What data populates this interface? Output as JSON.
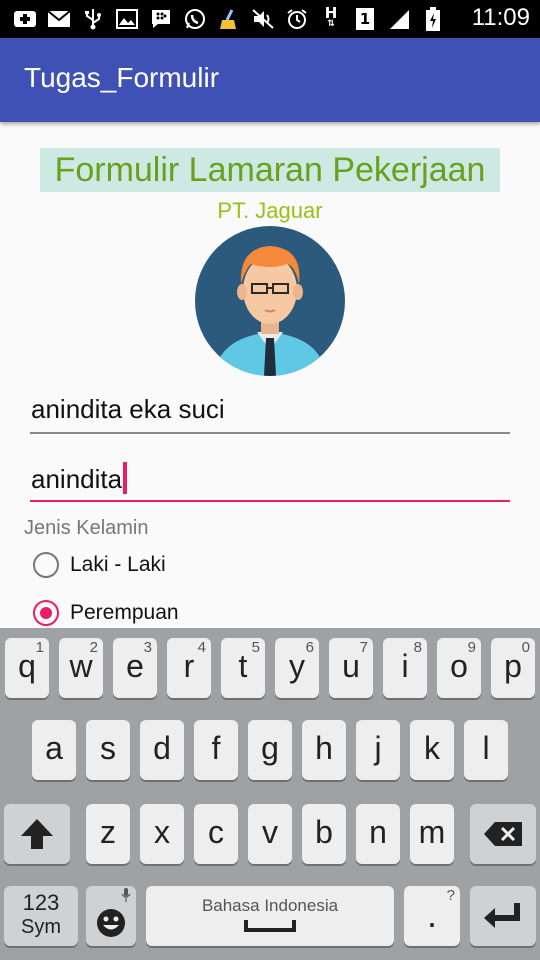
{
  "status_bar": {
    "time": "11:09",
    "icons": [
      "plus-icon",
      "mail-icon",
      "usb-icon",
      "image-icon",
      "bbm-icon",
      "whatsapp-icon",
      "cleaner-icon",
      "mute-icon",
      "alarm-icon",
      "h-signal-icon",
      "sim1-icon",
      "signal-icon",
      "battery-icon"
    ],
    "h_text": "H",
    "sim_text": "1"
  },
  "app_bar": {
    "title": "Tugas_Formulir",
    "color": "#3f51b5"
  },
  "form": {
    "title": "Formulir Lamaran Pekerjaan",
    "subtitle": "PT. Jaguar",
    "field1_value": "anindita eka suci",
    "field2_value": "anindita",
    "gender_label": "Jenis Kelamin",
    "gender_options": [
      {
        "label": "Laki - Laki",
        "checked": false
      },
      {
        "label": "Perempuan",
        "checked": true
      }
    ],
    "accent_color": "#e91e63",
    "title_color": "#6aa11c",
    "title_bg": "#cde9e3",
    "subtitle_color": "#96c11a"
  },
  "keyboard": {
    "row1": [
      {
        "k": "q",
        "h": "1"
      },
      {
        "k": "w",
        "h": "2"
      },
      {
        "k": "e",
        "h": "3"
      },
      {
        "k": "r",
        "h": "4"
      },
      {
        "k": "t",
        "h": "5"
      },
      {
        "k": "y",
        "h": "6"
      },
      {
        "k": "u",
        "h": "7"
      },
      {
        "k": "i",
        "h": "8"
      },
      {
        "k": "o",
        "h": "9"
      },
      {
        "k": "p",
        "h": "0"
      }
    ],
    "row2": [
      {
        "k": "a"
      },
      {
        "k": "s"
      },
      {
        "k": "d"
      },
      {
        "k": "f"
      },
      {
        "k": "g"
      },
      {
        "k": "h"
      },
      {
        "k": "j"
      },
      {
        "k": "k"
      },
      {
        "k": "l"
      }
    ],
    "row3": [
      {
        "k": "z"
      },
      {
        "k": "x"
      },
      {
        "k": "c"
      },
      {
        "k": "v"
      },
      {
        "k": "b"
      },
      {
        "k": "n"
      },
      {
        "k": "m"
      }
    ],
    "shift_icon": "shift-icon",
    "backspace_icon": "backspace-icon",
    "symbols_line1": "123",
    "symbols_line2": "Sym",
    "emoji_icon": "emoji-icon",
    "mic_icon": "mic-icon",
    "space_label": "Bahasa Indonesia",
    "period": ".",
    "period_hint": "?",
    "enter_icon": "enter-icon"
  }
}
